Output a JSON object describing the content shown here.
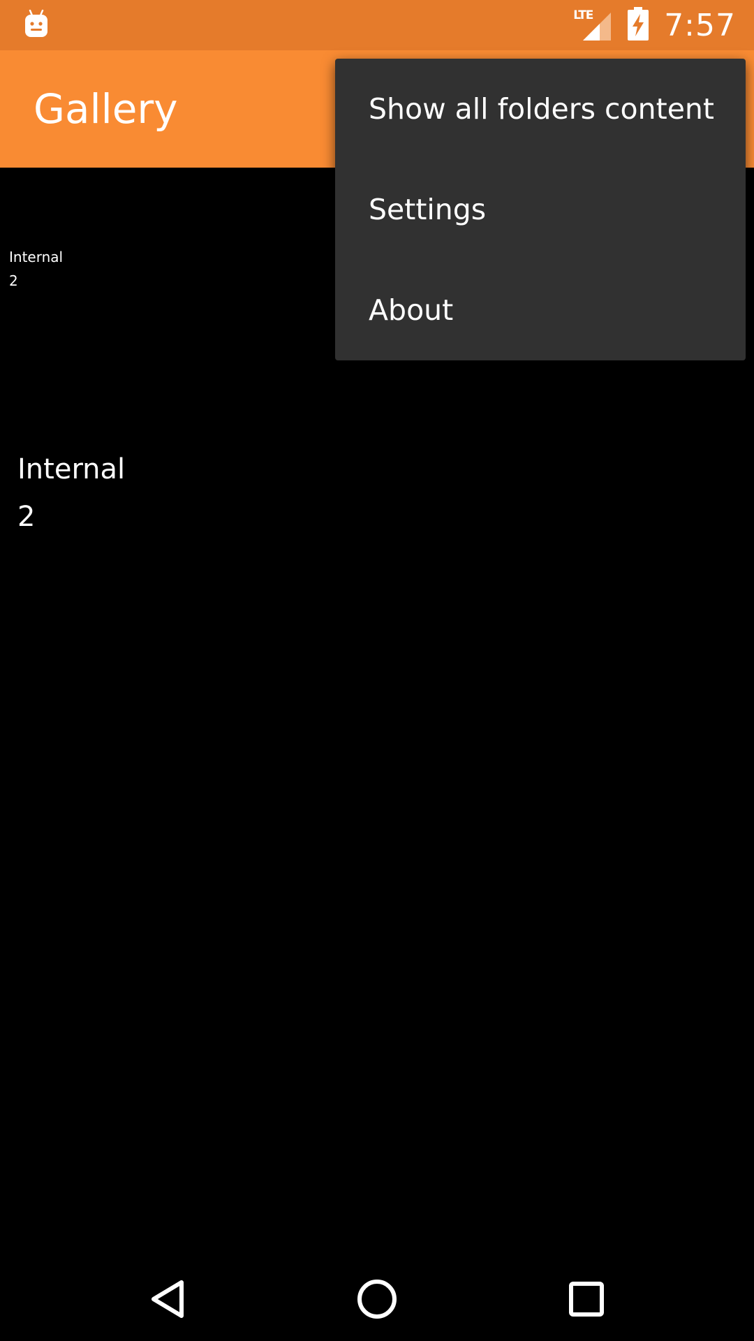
{
  "status_bar": {
    "time": "7:57",
    "network_label": "LTE",
    "icons": [
      "android-notification-icon",
      "signal-icon",
      "battery-charging-icon"
    ]
  },
  "app_bar": {
    "title": "Gallery"
  },
  "folders": [
    {
      "name": "Internal",
      "count": "2"
    },
    {
      "name": "Internal",
      "count": "2"
    }
  ],
  "overflow_menu": {
    "items": [
      {
        "label": "Show all folders content"
      },
      {
        "label": "Settings"
      },
      {
        "label": "About"
      }
    ]
  },
  "nav_bar": {
    "icons": [
      "back-icon",
      "home-icon",
      "recents-icon"
    ]
  },
  "colors": {
    "status_bar": "#e57b2b",
    "app_bar": "#f98b33",
    "menu_background": "#313131",
    "background": "#000000"
  }
}
